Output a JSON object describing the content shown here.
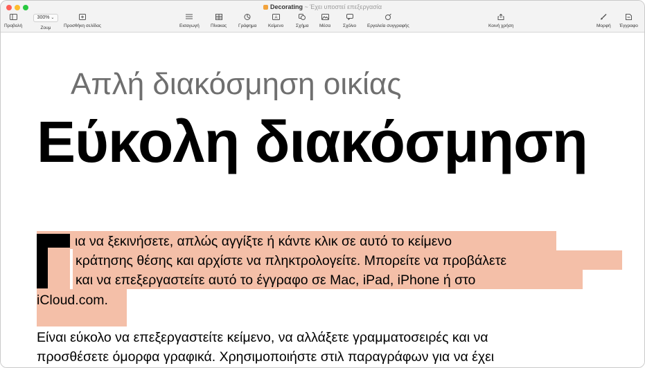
{
  "window": {
    "title": "Decorating",
    "subtitle": "~ Έχει υποστεί επεξεργασία"
  },
  "toolbar": {
    "view_label": "Προβολή",
    "zoom_value": "300%",
    "zoom_label": "Ζουμ",
    "add_page_label": "Προσθήκη σελίδας",
    "insert_label": "Εισαγωγή",
    "table_label": "Πίνακας",
    "chart_label": "Γράφημα",
    "text_label": "Κείμενο",
    "shape_label": "Σχήμα",
    "media_label": "Μέσα",
    "comment_label": "Σχόλιο",
    "authoring_label": "Εργαλεία συγγραφής",
    "share_label": "Κοινή χρήση",
    "format_label": "Μορφή",
    "document_label": "Έγγραφο"
  },
  "document": {
    "subtitle": "Απλή διακόσμηση οικίας",
    "headline": "Εύκολη διακόσμηση",
    "dropcap": "Γ",
    "paragraph1_lines": [
      "ια να ξεκινήσετε, απλώς αγγίξτε ή κάντε κλικ σε αυτό το κείμενο",
      "κράτησης θέσης και αρχίστε να πληκτρολογείτε. Μπορείτε να προβάλετε",
      "και να επεξεργαστείτε αυτό το έγγραφο σε Mac, iPad, iPhone ή στο",
      "iCloud.com."
    ],
    "paragraph2_lines": [
      "Είναι εύκολο να επεξεργαστείτε κείμενο, να αλλάξετε γραμματοσειρές και να",
      "προσθέσετε όμορφα γραφικά. Χρησιμοποιήστε στιλ παραγράφων για να έχει"
    ]
  },
  "colors": {
    "selection": "#f4bfa8",
    "subtitle_text": "#6f6f6f",
    "body_text": "#000000"
  }
}
